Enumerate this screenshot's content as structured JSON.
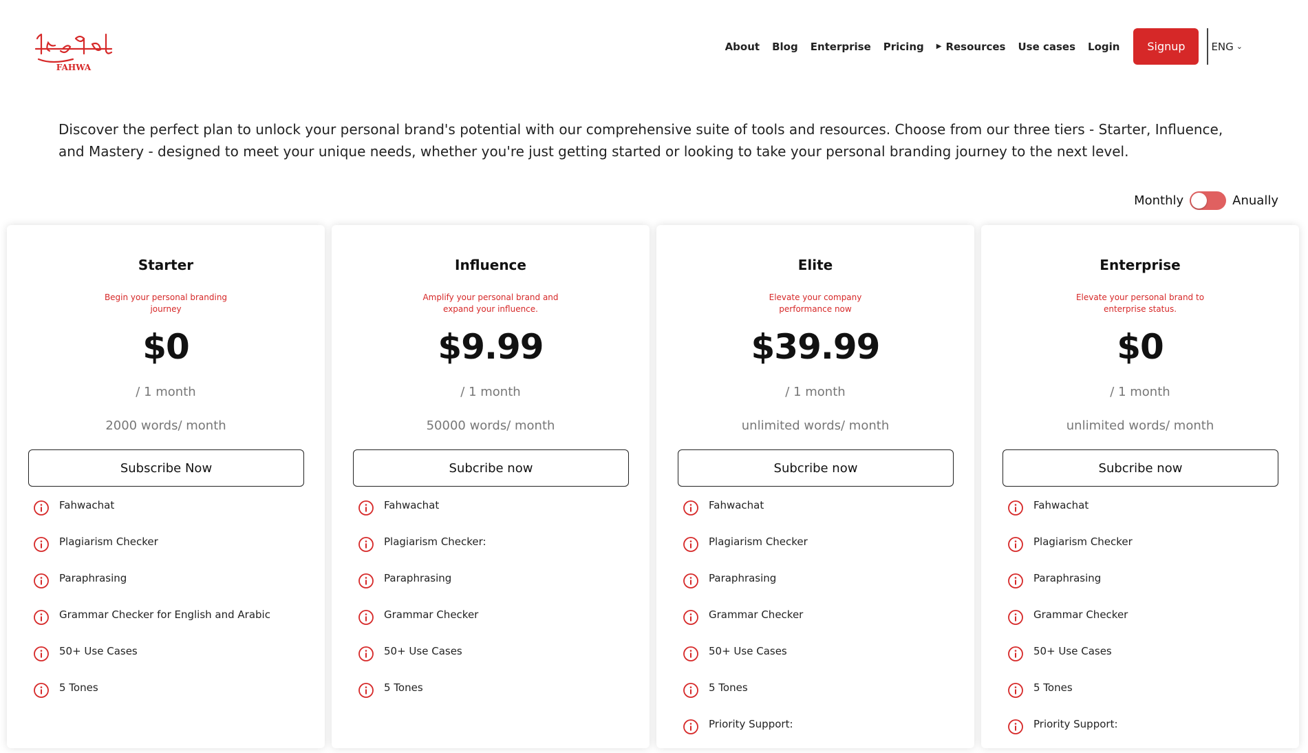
{
  "brand": {
    "logo_text": "FAHWA",
    "logo_arabic": "الفحوى",
    "accent_color": "#d62828"
  },
  "nav": {
    "items": [
      "About",
      "Blog",
      "Enterprise",
      "Pricing",
      "Resources",
      "Use cases",
      "Login"
    ],
    "resources_caret_icon": "triangle-right-icon",
    "signup_label": "Signup",
    "language": "ENG",
    "language_icon": "chevron-down-icon"
  },
  "intro": {
    "text": "Discover the perfect plan to unlock your personal brand's potential with our comprehensive suite of tools and resources. Choose from our three tiers - Starter, Influence, and Mastery - designed to meet your unique needs, whether you're just getting started or looking to take your personal branding journey to the next level."
  },
  "billing": {
    "monthly_label": "Monthly",
    "annual_label": "Anually",
    "toggle_state": "monthly",
    "toggle_color": "#e06060"
  },
  "plans": [
    {
      "name": "Starter",
      "subtitle": "Begin your personal branding journey",
      "price": "$0",
      "period": "/ 1 month",
      "words": "2000 words/ month",
      "button": "Subscribe Now",
      "features": [
        "Fahwachat",
        "Plagiarism Checker",
        "Paraphrasing",
        "Grammar Checker for English and Arabic",
        "50+ Use Cases",
        "5 Tones"
      ]
    },
    {
      "name": "Influence",
      "subtitle": "Amplify your personal brand and expand your influence.",
      "price": "$9.99",
      "period": "/ 1 month",
      "words": "50000 words/ month",
      "button": "Subcribe now",
      "features": [
        "Fahwachat",
        "Plagiarism Checker:",
        "Paraphrasing",
        "Grammar Checker",
        "50+ Use Cases",
        "5 Tones"
      ]
    },
    {
      "name": "Elite",
      "subtitle": "Elevate your company performance now",
      "price": "$39.99",
      "period": "/ 1 month",
      "words": "unlimited words/ month",
      "button": "Subcribe now",
      "features": [
        "Fahwachat",
        "Plagiarism Checker",
        "Paraphrasing",
        "Grammar Checker",
        "50+ Use Cases",
        "5 Tones",
        "Priority Support:"
      ]
    },
    {
      "name": "Enterprise",
      "subtitle": "Elevate your personal brand to enterprise status.",
      "price": "$0",
      "period": "/ 1 month",
      "words": "unlimited words/ month",
      "button": "Subcribe now",
      "features": [
        "Fahwachat",
        "Plagiarism Checker",
        "Paraphrasing",
        "Grammar Checker",
        "50+ Use Cases",
        "5 Tones",
        "Priority Support:"
      ]
    }
  ],
  "feature_icon": "info-circle-icon"
}
